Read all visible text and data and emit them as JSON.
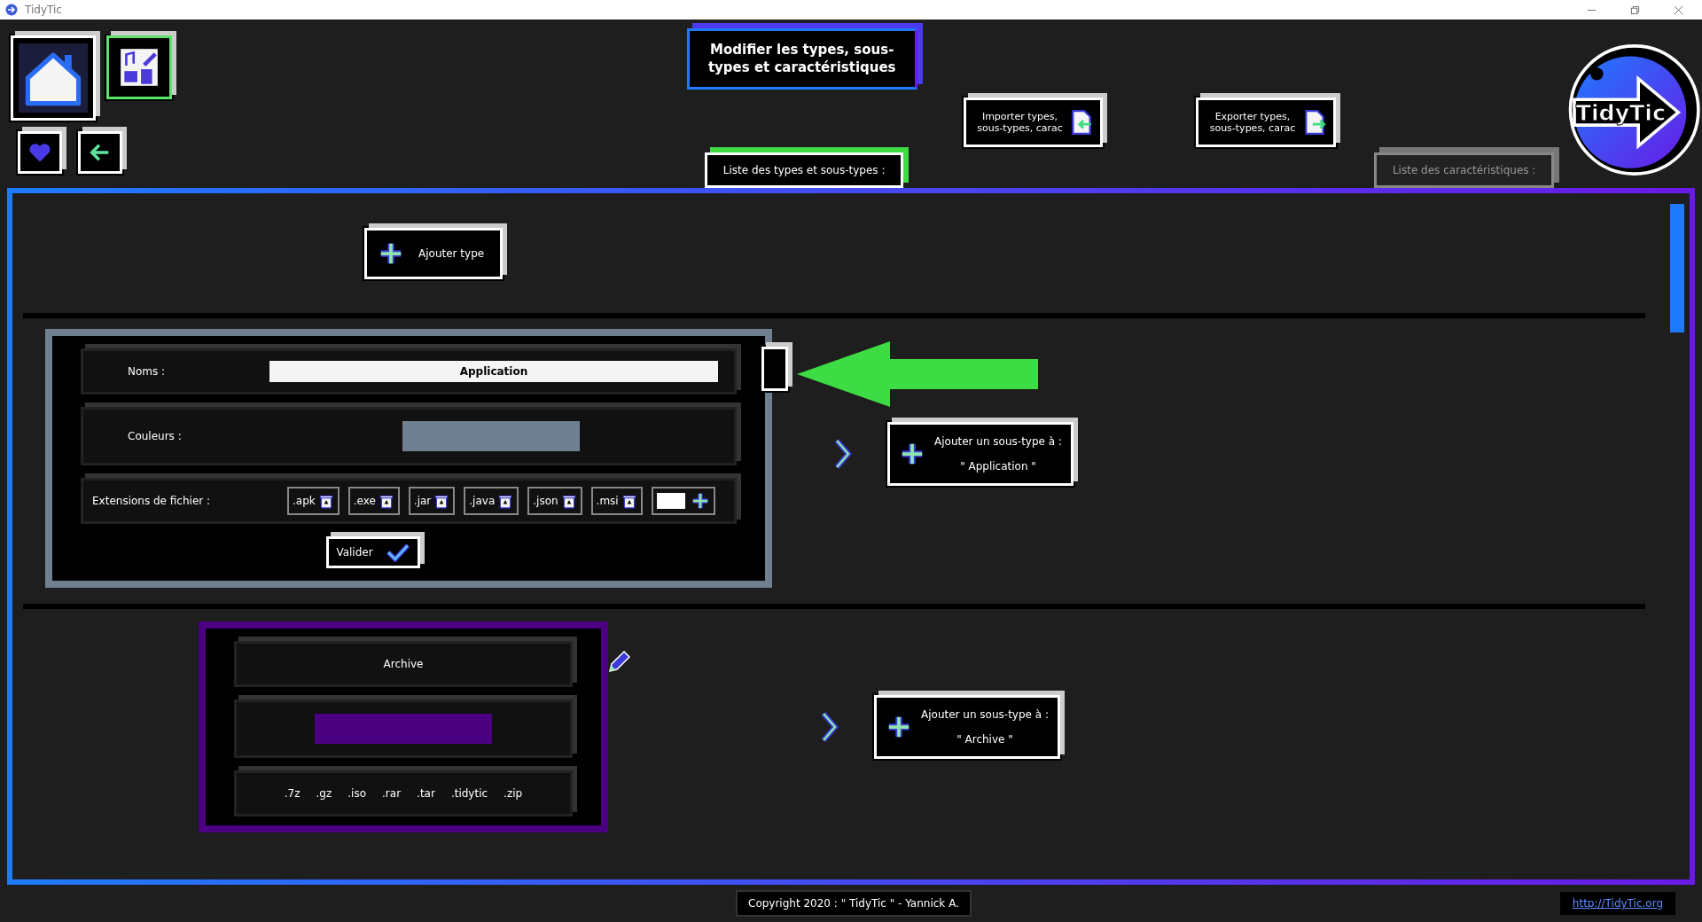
{
  "window": {
    "title": "TidyTic"
  },
  "header": {
    "title": "Modifier les types, sous-types et caractéristiques",
    "import_button": "Importer types, sous-types, carac",
    "export_button": "Exporter types, sous-types, carac",
    "logo_text": "TidyTic"
  },
  "tabs": [
    {
      "label": "Liste des types et sous-types :",
      "selected": true
    },
    {
      "label": "Liste des caractéristiques :",
      "selected": false
    }
  ],
  "add_type_button": "Ajouter type",
  "types": [
    {
      "editing": true,
      "name_label": "Noms :",
      "name": "Application",
      "color_label": "Couleurs :",
      "color": "#708090",
      "extensions_label": "Extensions de fichier :",
      "extensions": [
        ".apk",
        ".exe",
        ".jar",
        ".java",
        ".json",
        ".msi"
      ],
      "validate_button": "Valider",
      "subtype_button": "Ajouter un sous-type à :",
      "subtype_target": "\" Application \""
    },
    {
      "editing": false,
      "name": "Archive",
      "color": "#4b0082",
      "extensions": [
        ".7z",
        ".gz",
        ".iso",
        ".rar",
        ".tar",
        ".tidytic",
        ".zip"
      ],
      "subtype_button": "Ajouter un sous-type à :",
      "subtype_target": "\" Archive \""
    }
  ],
  "footer": {
    "copyright": "Copyright 2020 : \" TidyTic \" - Yannick A.",
    "link": "http://TidyTic.org"
  }
}
